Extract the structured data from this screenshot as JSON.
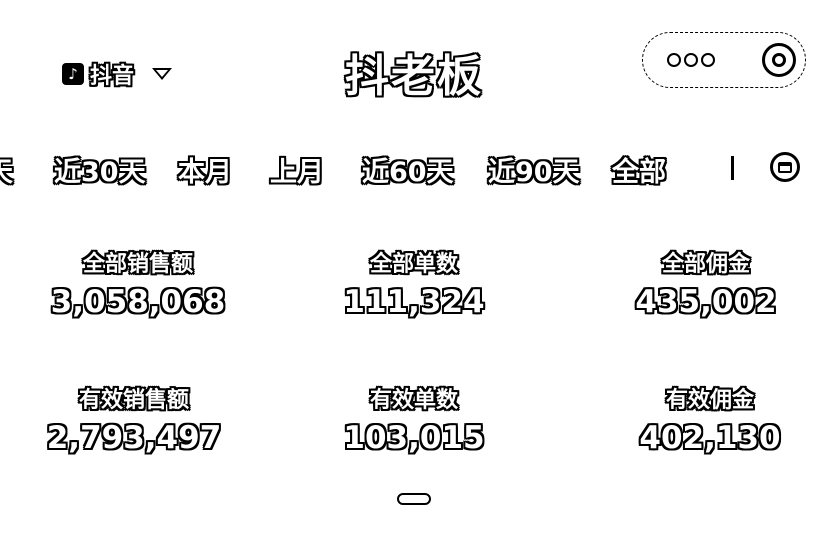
{
  "header": {
    "app_name": "抖音",
    "app_logo_glyph": "♪",
    "title": "抖老板"
  },
  "tabs": [
    {
      "label": "天"
    },
    {
      "label": "近30天"
    },
    {
      "label": "本月"
    },
    {
      "label": "上月"
    },
    {
      "label": "近60天"
    },
    {
      "label": "近90天"
    },
    {
      "label": "全部"
    }
  ],
  "metrics": [
    {
      "label": "全部销售额",
      "value": "3,058,068"
    },
    {
      "label": "全部单数",
      "value": "111,324"
    },
    {
      "label": "全部佣金",
      "value": "435,002"
    },
    {
      "label": "有效销售额",
      "value": "2,793,497"
    },
    {
      "label": "有效单数",
      "value": "103,015"
    },
    {
      "label": "有效佣金",
      "value": "402,130"
    }
  ],
  "icons": {
    "app_logo": "douyin-logo-icon",
    "dropdown": "chevron-down-icon",
    "more": "more-dots-icon",
    "close": "target-icon",
    "calendar": "calendar-icon"
  }
}
